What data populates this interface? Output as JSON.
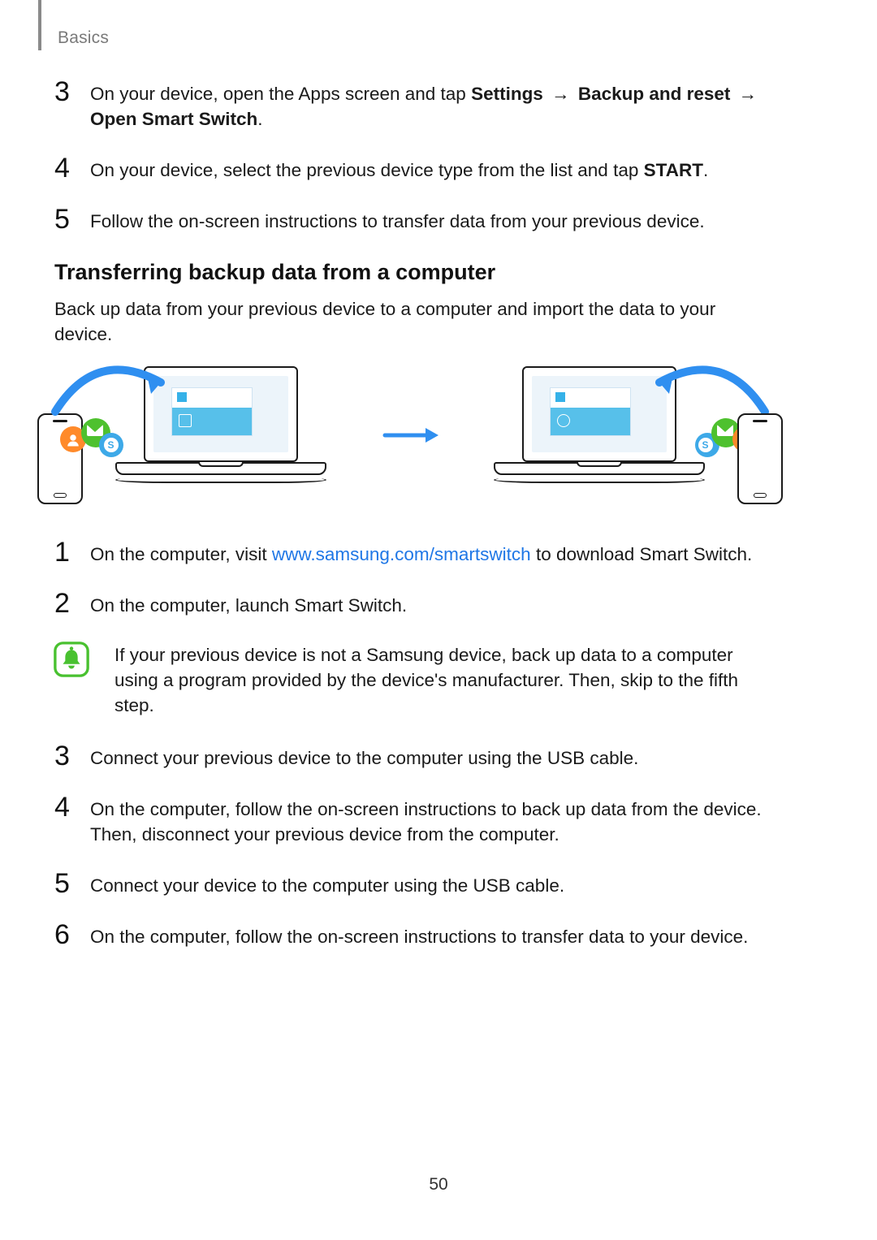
{
  "header": {
    "section": "Basics"
  },
  "page_number": "50",
  "steps_top": [
    {
      "num": "3",
      "parts": [
        {
          "t": "On your device, open the Apps screen and tap "
        },
        {
          "t": "Settings",
          "b": true
        },
        {
          "t": " → ",
          "arrow": true
        },
        {
          "t": "Backup and reset",
          "b": true
        },
        {
          "t": " → ",
          "arrow": true
        },
        {
          "t": "Open Smart Switch",
          "b": true
        },
        {
          "t": "."
        }
      ]
    },
    {
      "num": "4",
      "parts": [
        {
          "t": "On your device, select the previous device type from the list and tap "
        },
        {
          "t": "START",
          "b": true
        },
        {
          "t": "."
        }
      ]
    },
    {
      "num": "5",
      "parts": [
        {
          "t": "Follow the on-screen instructions to transfer data from your previous device."
        }
      ]
    }
  ],
  "section_heading": "Transferring backup data from a computer",
  "section_intro": "Back up data from your previous device to a computer and import the data to your device.",
  "steps_bottom_a": [
    {
      "num": "1",
      "parts": [
        {
          "t": "On the computer, visit "
        },
        {
          "t": "www.samsung.com/smartswitch",
          "link": true
        },
        {
          "t": " to download Smart Switch."
        }
      ]
    },
    {
      "num": "2",
      "parts": [
        {
          "t": "On the computer, launch Smart Switch."
        }
      ]
    }
  ],
  "note_text": "If your previous device is not a Samsung device, back up data to a computer using a program provided by the device's manufacturer. Then, skip to the fifth step.",
  "steps_bottom_b": [
    {
      "num": "3",
      "parts": [
        {
          "t": "Connect your previous device to the computer using the USB cable."
        }
      ]
    },
    {
      "num": "4",
      "parts": [
        {
          "t": "On the computer, follow the on-screen instructions to back up data from the device. Then, disconnect your previous device from the computer."
        }
      ]
    },
    {
      "num": "5",
      "parts": [
        {
          "t": "Connect your device to the computer using the USB cable."
        }
      ]
    },
    {
      "num": "6",
      "parts": [
        {
          "t": "On the computer, follow the on-screen instructions to transfer data to your device."
        }
      ]
    }
  ]
}
